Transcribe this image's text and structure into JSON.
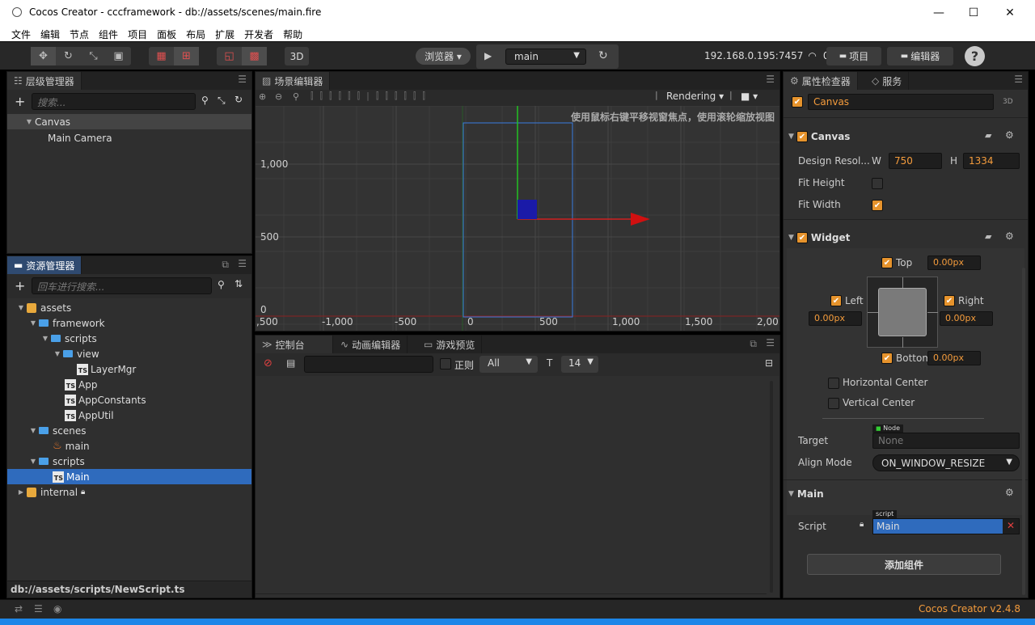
{
  "window": {
    "title": "Cocos Creator - cccframework - db://assets/scenes/main.fire",
    "minimize": "—",
    "maximize": "☐",
    "close": "✕"
  },
  "menu": [
    "文件",
    "编辑",
    "节点",
    "组件",
    "项目",
    "面板",
    "布局",
    "扩展",
    "开发者",
    "帮助"
  ],
  "toolbar": {
    "mode_3d": "3D",
    "preview_target": "浏览器 ▾",
    "scene_select": "main",
    "ip": "192.168.0.195:7457",
    "connections": "0",
    "project_btn": "项目",
    "editor_btn": "编辑器",
    "help": "?"
  },
  "hierarchy": {
    "tab": "层级管理器",
    "search_placeholder": "搜索...",
    "nodes": [
      "Canvas",
      "Main Camera"
    ]
  },
  "assets": {
    "tab": "资源管理器",
    "search_placeholder": "回车进行搜索...",
    "tree": [
      "assets",
      "framework",
      "scripts",
      "view",
      "LayerMgr",
      "App",
      "AppConstants",
      "AppUtil",
      "scenes",
      "main",
      "scripts",
      "Main",
      "internal"
    ],
    "status_path": "db://assets/scripts/NewScript.ts"
  },
  "scene": {
    "tab": "场景编辑器",
    "rendering": "Rendering",
    "hint": "使用鼠标右键平移视窗焦点，使用滚轮缩放视图",
    "y_ticks": [
      "1,000",
      "500",
      "0"
    ],
    "x_ticks": [
      ",500",
      "-1,000",
      "-500",
      "0",
      "500",
      "1,000",
      "1,500",
      "2,00"
    ]
  },
  "console": {
    "tabs": [
      "控制台",
      "动画编辑器",
      "游戏预览"
    ],
    "regex": "正则",
    "level": "All",
    "font_size": "14"
  },
  "inspector": {
    "tabs": [
      "属性检查器",
      "服务"
    ],
    "node_name": "Canvas",
    "node_3d": "3D",
    "canvas": {
      "title": "Canvas",
      "design_label": "Design Resol...",
      "w_label": "W",
      "w": "750",
      "h_label": "H",
      "h": "1334",
      "fit_height": "Fit Height",
      "fit_width": "Fit Width"
    },
    "widget": {
      "title": "Widget",
      "top": "Top",
      "top_val": "0.00px",
      "left": "Left",
      "left_val": "0.00px",
      "right": "Right",
      "right_val": "0.00px",
      "bottom": "Bottom",
      "bottom_val": "0.00px",
      "hcenter": "Horizontal Center",
      "vcenter": "Vertical Center",
      "target_label": "Target",
      "target_type": "Node",
      "target_val": "None",
      "align_label": "Align Mode",
      "align_val": "ON_WINDOW_RESIZE"
    },
    "main": {
      "title": "Main",
      "script_label": "Script",
      "script_type": "script",
      "script_val": "Main"
    },
    "add_component": "添加组件"
  },
  "statusbar": {
    "version": "Cocos Creator v2.4.8"
  },
  "colors": {
    "accent_orange": "#e6932c",
    "selection_blue": "#2f6bbd",
    "panel_bg": "#2f2f2f"
  }
}
